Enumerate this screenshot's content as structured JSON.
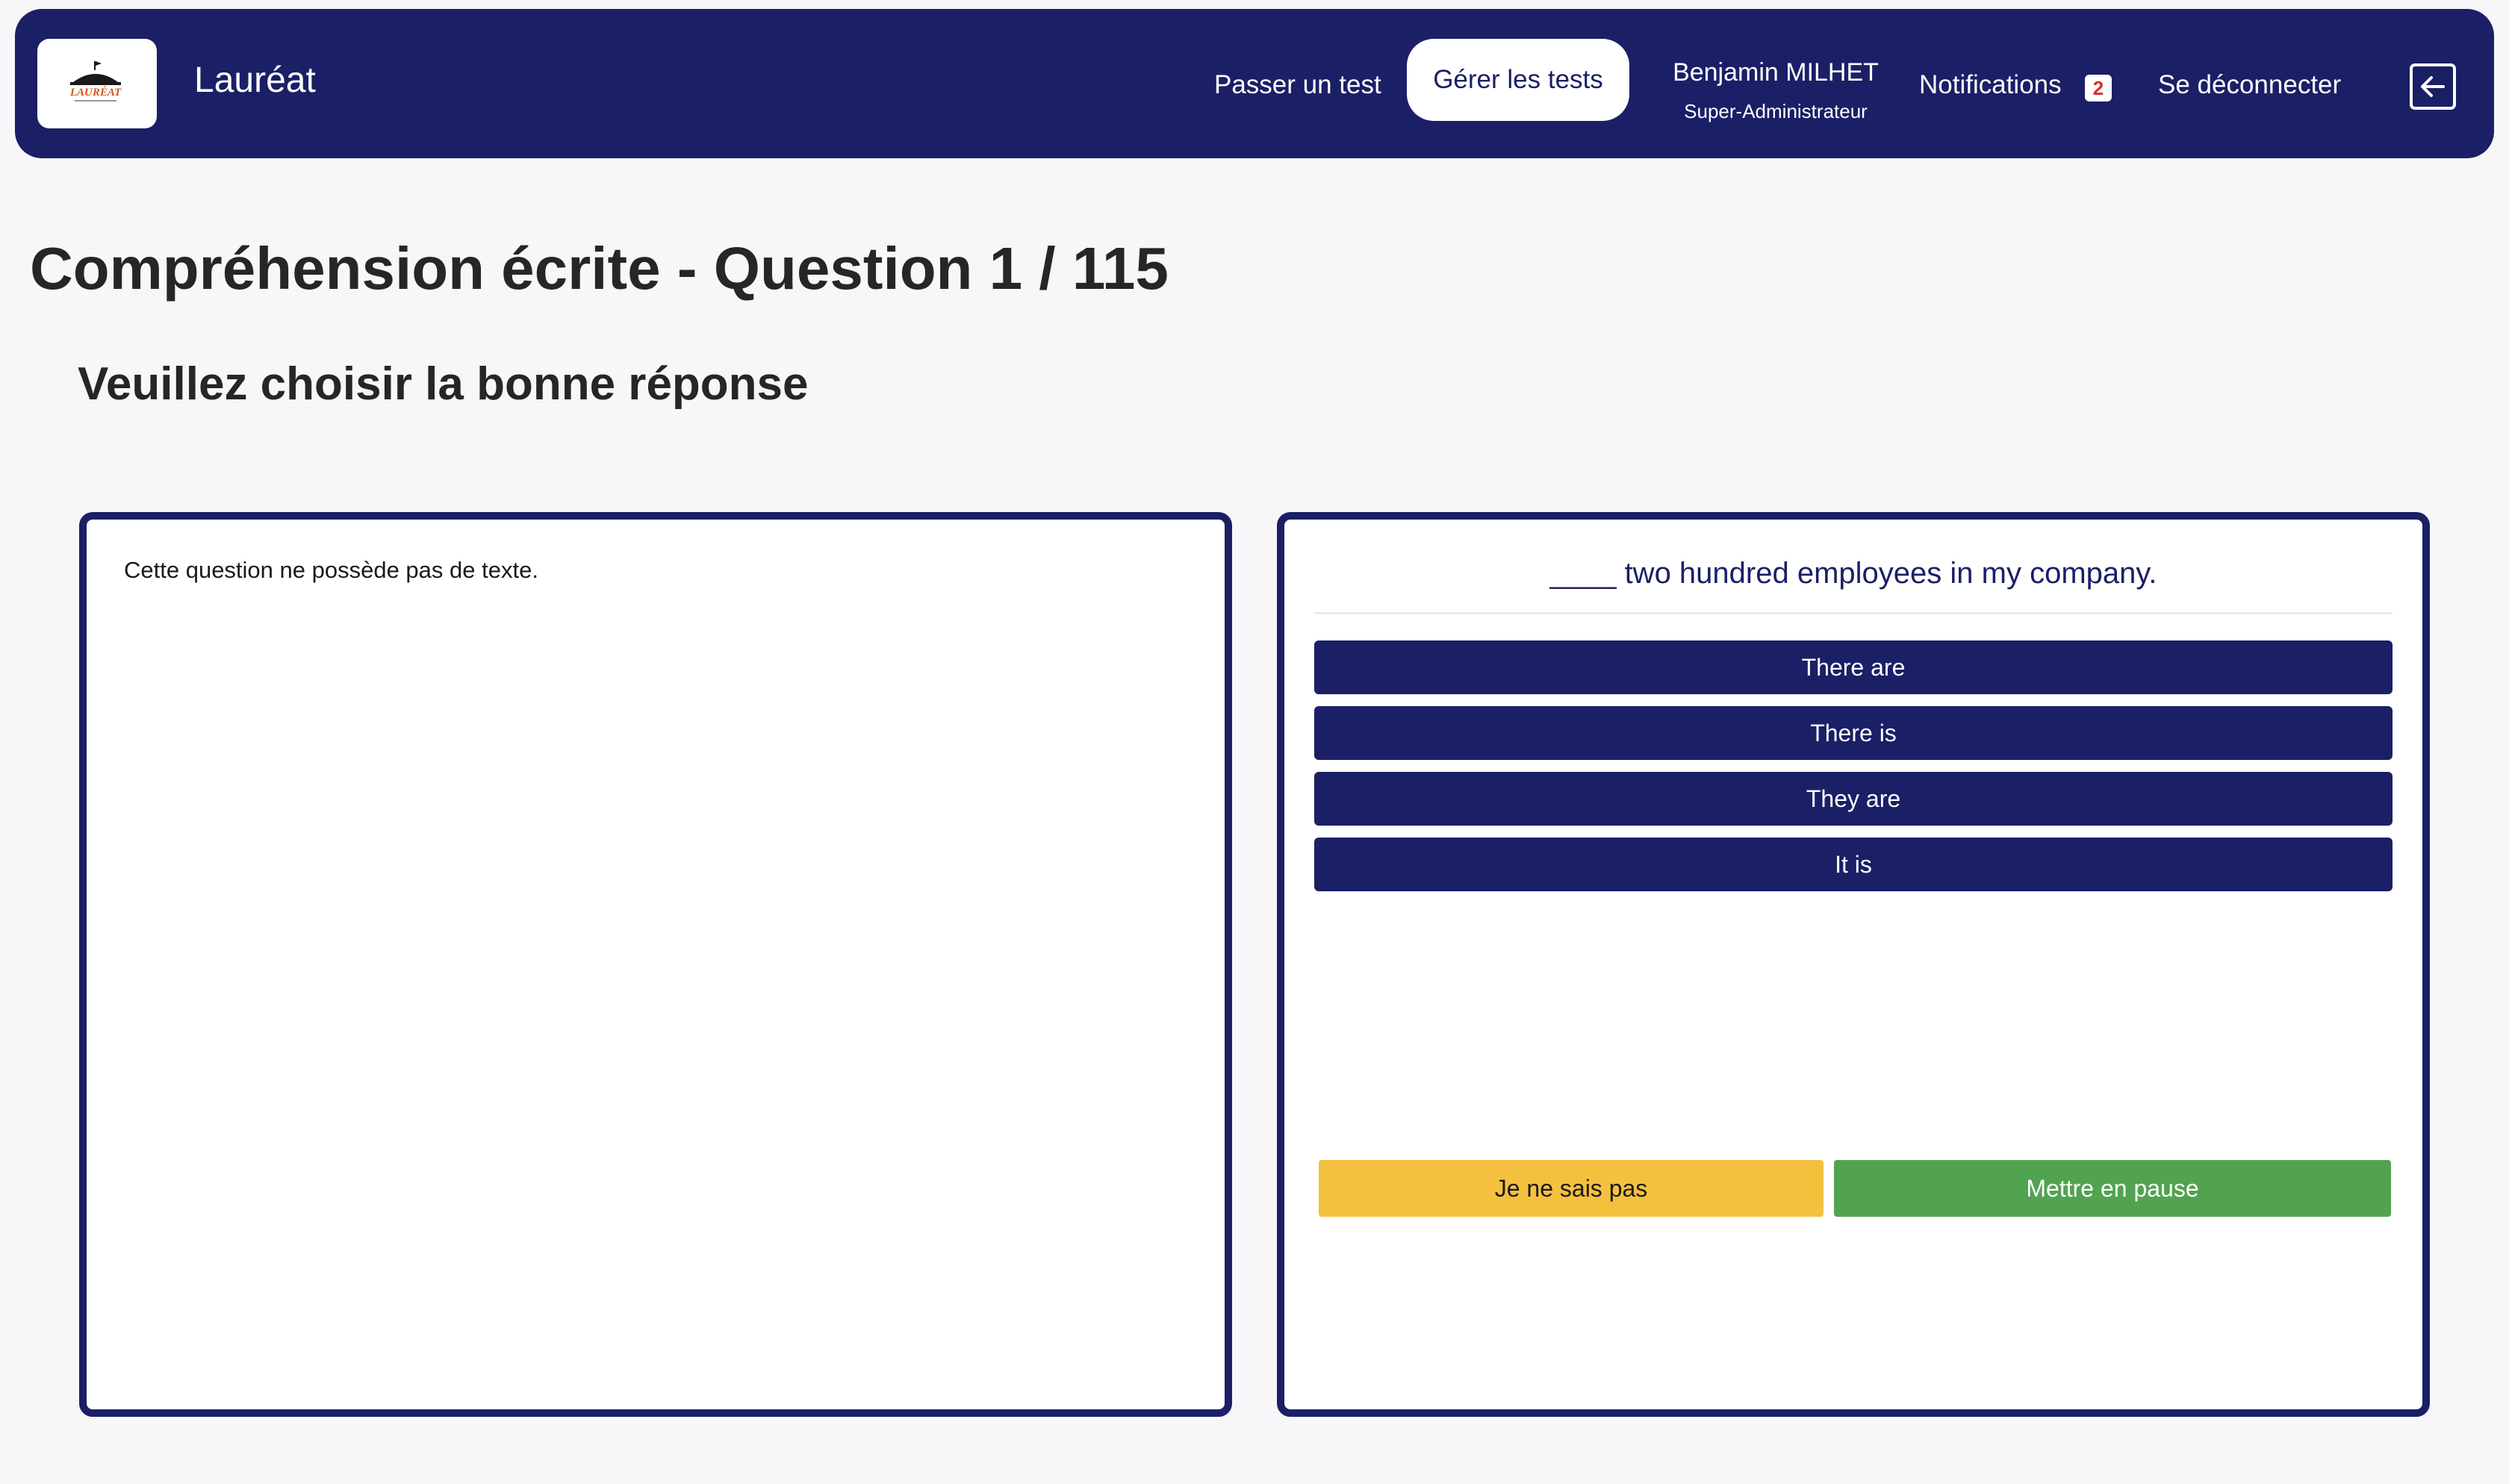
{
  "header": {
    "logo_text": "LAURÉAT",
    "brand": "Lauréat",
    "nav": {
      "take_test": "Passer un test",
      "manage_tests": "Gérer les tests",
      "user_name": "Benjamin MILHET",
      "user_role": "Super-Administrateur",
      "notifications": "Notifications",
      "notifications_count": "2",
      "logout": "Se déconnecter"
    },
    "logout_icon": "arrow-left-box-icon"
  },
  "main": {
    "title": "Compréhension écrite - Question 1 / 115",
    "instruction": "Veuillez choisir la bonne réponse"
  },
  "left_panel": {
    "text": "Cette question ne possède pas de texte."
  },
  "right_panel": {
    "question": "____ two hundred employees in my company.",
    "options": [
      "There are",
      "There is",
      "They are",
      "It is"
    ],
    "dont_know": "Je ne sais pas",
    "pause": "Mettre en pause"
  },
  "colors": {
    "primary": "#1b1f66",
    "warning": "#f4c13f",
    "success": "#52a350",
    "badge_text": "#d3302f",
    "background": "#f7f7f9"
  }
}
